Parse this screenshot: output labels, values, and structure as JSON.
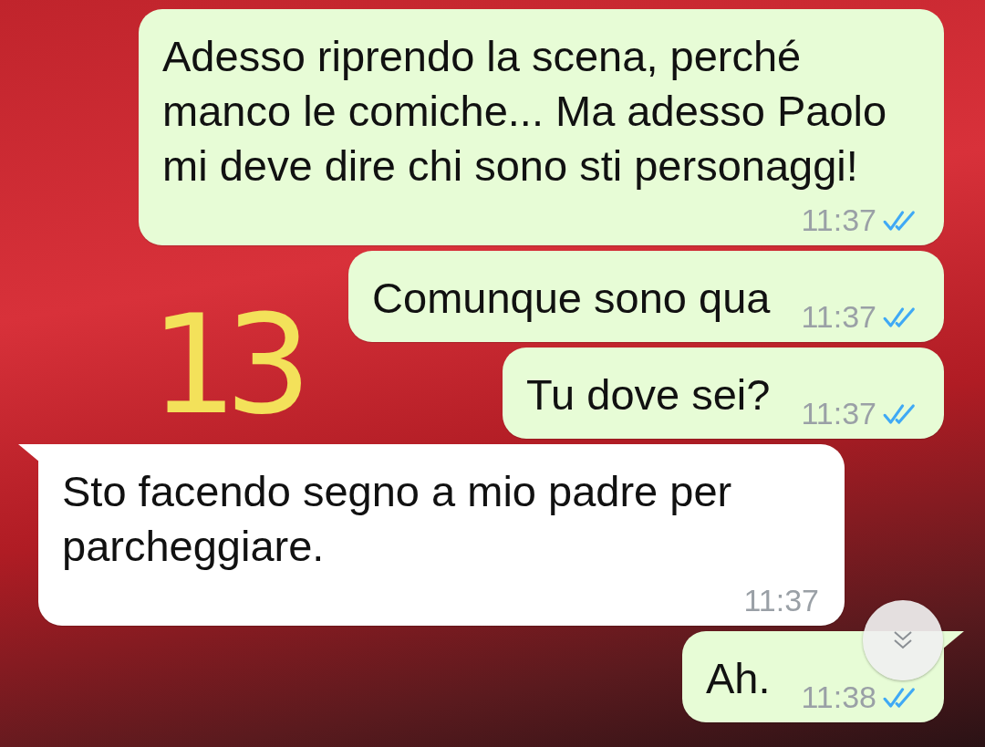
{
  "messages": [
    {
      "kind": "outgoing",
      "text": "Adesso riprendo la scena, perché manco le comiche... Ma adesso Paolo mi deve dire chi sono sti personaggi!",
      "time": "11:37",
      "read": true,
      "tail": false
    },
    {
      "kind": "outgoing",
      "text": "Comunque sono qua",
      "time": "11:37",
      "read": true,
      "tail": false
    },
    {
      "kind": "outgoing",
      "text": "Tu dove sei?",
      "time": "11:37",
      "read": true,
      "tail": false
    },
    {
      "kind": "incoming",
      "text": "Sto facendo segno a mio padre per parcheggiare.",
      "time": "11:37",
      "tail": true
    },
    {
      "kind": "outgoing",
      "text": "Ah.",
      "time": "11:38",
      "read": true,
      "tail": true
    }
  ],
  "annotation": "13"
}
